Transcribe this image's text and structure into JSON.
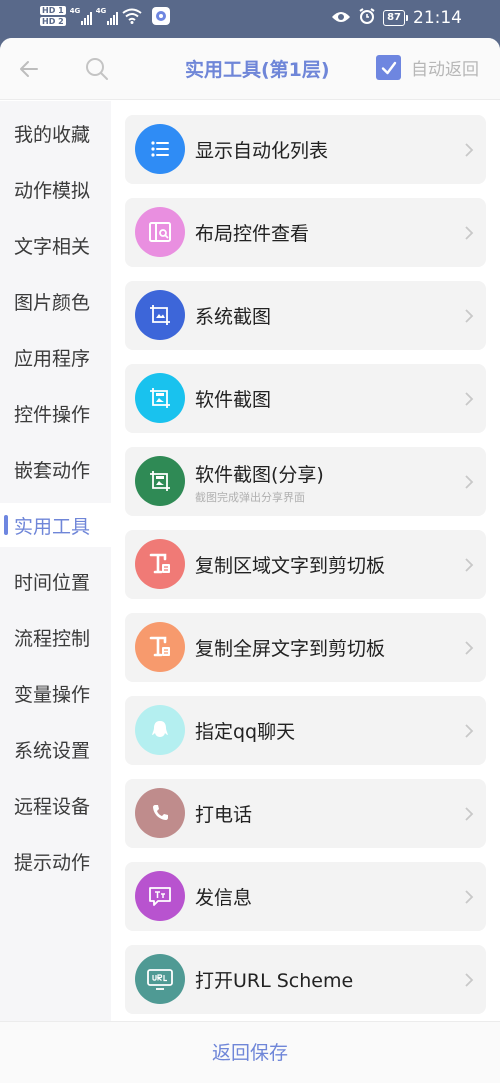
{
  "status_bar": {
    "hd_top": "HD 1",
    "hd_bottom": "HD 2",
    "net1": "4G",
    "net2": "4G",
    "battery": "87",
    "time": "21:14",
    "icons": [
      "signal-icon",
      "wifi-icon",
      "app-badge-icon",
      "eye-icon",
      "alarm-icon",
      "battery-icon"
    ]
  },
  "header": {
    "title": "实用工具(第1层)",
    "auto_return_label": "自动返回",
    "auto_return_checked": true
  },
  "sidebar": {
    "items": [
      {
        "label": "我的收藏"
      },
      {
        "label": "动作模拟"
      },
      {
        "label": "文字相关"
      },
      {
        "label": "图片颜色"
      },
      {
        "label": "应用程序"
      },
      {
        "label": "控件操作"
      },
      {
        "label": "嵌套动作"
      },
      {
        "label": "实用工具"
      },
      {
        "label": "时间位置"
      },
      {
        "label": "流程控制"
      },
      {
        "label": "变量操作"
      },
      {
        "label": "系统设置"
      },
      {
        "label": "远程设备"
      },
      {
        "label": "提示动作"
      }
    ],
    "active_label": "实用工具"
  },
  "list": {
    "items": [
      {
        "label": "显示自动化列表",
        "icon": "list-icon",
        "color": "#2f8cf5"
      },
      {
        "label": "布局控件查看",
        "icon": "layout-inspect-icon",
        "color": "#e98fe0"
      },
      {
        "label": "系统截图",
        "icon": "screenshot-icon",
        "color": "#3d66d9"
      },
      {
        "label": "软件截图",
        "icon": "app-screenshot-icon",
        "color": "#19c2ee"
      },
      {
        "label": "软件截图(分享)",
        "sublabel": "截图完成弹出分享界面",
        "icon": "app-screenshot-share-icon",
        "color": "#2f8a55"
      },
      {
        "label": "复制区域文字到剪切板",
        "icon": "copy-text-icon",
        "color": "#f07a76"
      },
      {
        "label": "复制全屏文字到剪切板",
        "icon": "copy-text-icon",
        "color": "#f79a6d"
      },
      {
        "label": "指定qq聊天",
        "icon": "qq-icon",
        "color": "#b4eff0"
      },
      {
        "label": "打电话",
        "icon": "phone-icon",
        "color": "#bf8c8c"
      },
      {
        "label": "发信息",
        "icon": "message-icon",
        "color": "#b853cf"
      },
      {
        "label": "打开URL Scheme",
        "icon": "url-icon",
        "color": "#4f9a94"
      }
    ]
  },
  "footer": {
    "save_label": "返回保存"
  },
  "colors": {
    "accent": "#6e86e0",
    "status_bar": "#59698a"
  }
}
